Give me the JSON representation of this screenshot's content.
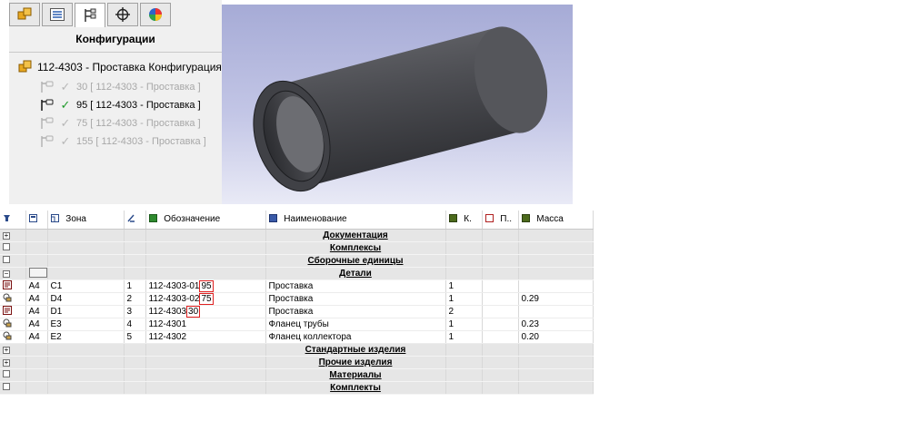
{
  "config_panel": {
    "title": "Конфигурации",
    "tabs": [
      {
        "icon": "assembly-icon"
      },
      {
        "icon": "property-manager-icon"
      },
      {
        "icon": "configuration-manager-icon",
        "active": true
      },
      {
        "icon": "dimxpert-icon"
      },
      {
        "icon": "display-manager-icon"
      }
    ],
    "root": {
      "icon": "assembly-icon",
      "label": "112-4303 - Проставка Конфигурация(и)"
    },
    "items": [
      {
        "label": "30 [ 112-4303 - Проставка ]",
        "active": false
      },
      {
        "label": "95 [ 112-4303 - Проставка ]",
        "active": true
      },
      {
        "label": "75 [ 112-4303 - Проставка ]",
        "active": false
      },
      {
        "label": "155 [ 112-4303 - Проставка ]",
        "active": false
      }
    ]
  },
  "table": {
    "columns": {
      "zone": "Зона",
      "designation": "Обозначение",
      "name": "Наименование",
      "qty": "К.",
      "note": "П..",
      "mass": "Масса"
    },
    "sections": {
      "documentation": "Документация",
      "complexes": "Комплексы",
      "assembly_units": "Сборочные единицы",
      "parts": "Детали",
      "standard": "Стандартные изделия",
      "other": "Прочие изделия",
      "materials": "Материалы",
      "kits": "Комплекты"
    },
    "parts": [
      {
        "format": "A4",
        "zone": "C1",
        "pos": "1",
        "designation_base": "112-4303-01",
        "designation_suffix": "95",
        "name": "Проставка",
        "qty": "1",
        "mass": ""
      },
      {
        "format": "A4",
        "zone": "D4",
        "pos": "2",
        "designation_base": "112-4303-02",
        "designation_suffix": "75",
        "name": "Проставка",
        "qty": "1",
        "mass": "0.29"
      },
      {
        "format": "A4",
        "zone": "D1",
        "pos": "3",
        "designation_base": "112-4303",
        "designation_suffix": "30",
        "name": "Проставка",
        "qty": "2",
        "mass": ""
      },
      {
        "format": "A4",
        "zone": "E3",
        "pos": "4",
        "designation_base": "112-4301",
        "designation_suffix": "",
        "name": "Фланец трубы",
        "qty": "1",
        "mass": "0.23"
      },
      {
        "format": "A4",
        "zone": "E2",
        "pos": "5",
        "designation_base": "112-4302",
        "designation_suffix": "",
        "name": "Фланец коллектора",
        "qty": "1",
        "mass": "0.20"
      }
    ]
  }
}
